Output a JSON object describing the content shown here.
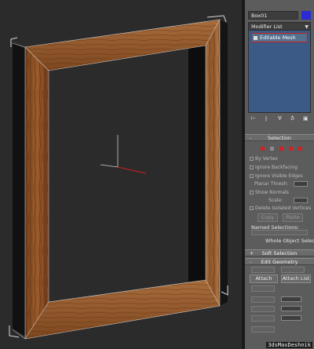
{
  "object_name": "Box01",
  "object_color": "#2b2bd6",
  "modifier_list": "Modifier List",
  "modifier_stack": {
    "items": [
      {
        "label": "Editable Mesh"
      }
    ]
  },
  "rollouts": {
    "selection": {
      "sign": "-",
      "title": "Selection"
    },
    "soft_selection": {
      "sign": "+",
      "title": "Soft Selection"
    },
    "edit_geometry": {
      "sign": "-",
      "title": "Edit Geometry"
    }
  },
  "selection_options": [
    "By Vertex",
    "Ignore Backfacing",
    "Ignore Visible Edges",
    "Planar Thresh:",
    "Show Normals",
    "Scale:",
    "Delete Isolated Vertices"
  ],
  "named_selections_label": "Named Selections:",
  "whole_object_selected": "Whole Object Selected",
  "buttons": {
    "attach": "Attach",
    "attach_list": "Attach List",
    "copy": "Copy",
    "paste": "Paste"
  },
  "watermark": "3dsMaxDeshnik",
  "colors": {
    "viewport_bg": "#2b2b2b",
    "panel_bg": "#5c5c5c",
    "stack_bg": "#3b5a86",
    "wood": "#8a4f24",
    "selection_red": "#c61f1f"
  }
}
